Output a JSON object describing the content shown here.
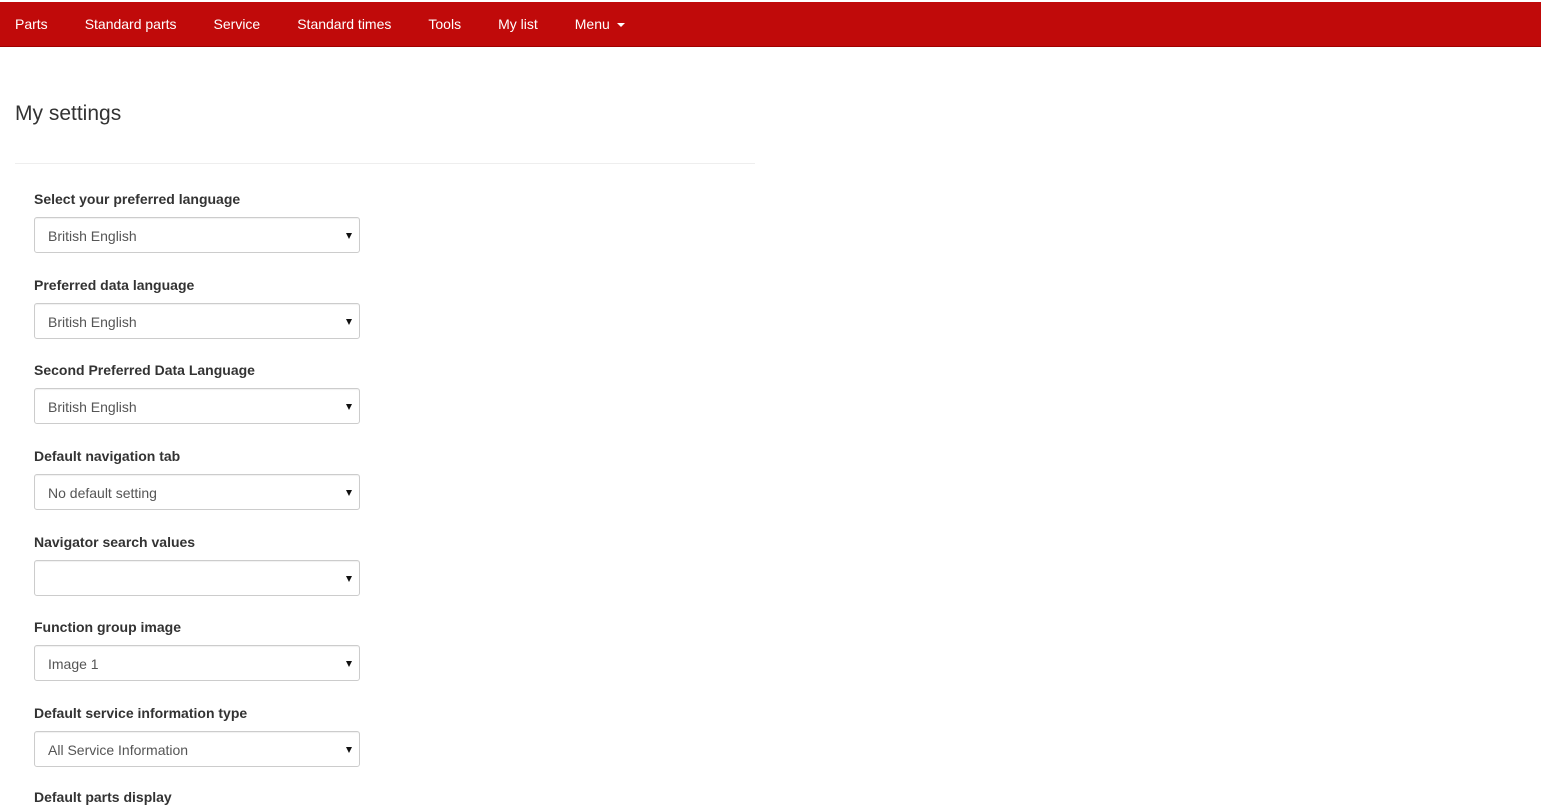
{
  "nav": {
    "items": [
      "Parts",
      "Standard parts",
      "Service",
      "Standard times",
      "Tools",
      "My list"
    ],
    "menu_label": "Menu"
  },
  "page": {
    "title": "My settings"
  },
  "settings": [
    {
      "label": "Select your preferred language",
      "value": "British English"
    },
    {
      "label": "Preferred data language",
      "value": "British English"
    },
    {
      "label": "Second Preferred Data Language",
      "value": "British English"
    },
    {
      "label": "Default navigation tab",
      "value": "No default setting"
    },
    {
      "label": "Navigator search values",
      "value": ""
    },
    {
      "label": "Function group image",
      "value": "Image 1"
    },
    {
      "label": "Default service information type",
      "value": "All Service Information"
    }
  ],
  "partial_field": {
    "label": "Default parts display"
  },
  "colors": {
    "topbar": "#c00a0a",
    "nav_text": "#ffffff"
  },
  "icons": {
    "menu_dropdown": "caret-down-icon",
    "select_dropdown": "triangle-down-icon"
  }
}
